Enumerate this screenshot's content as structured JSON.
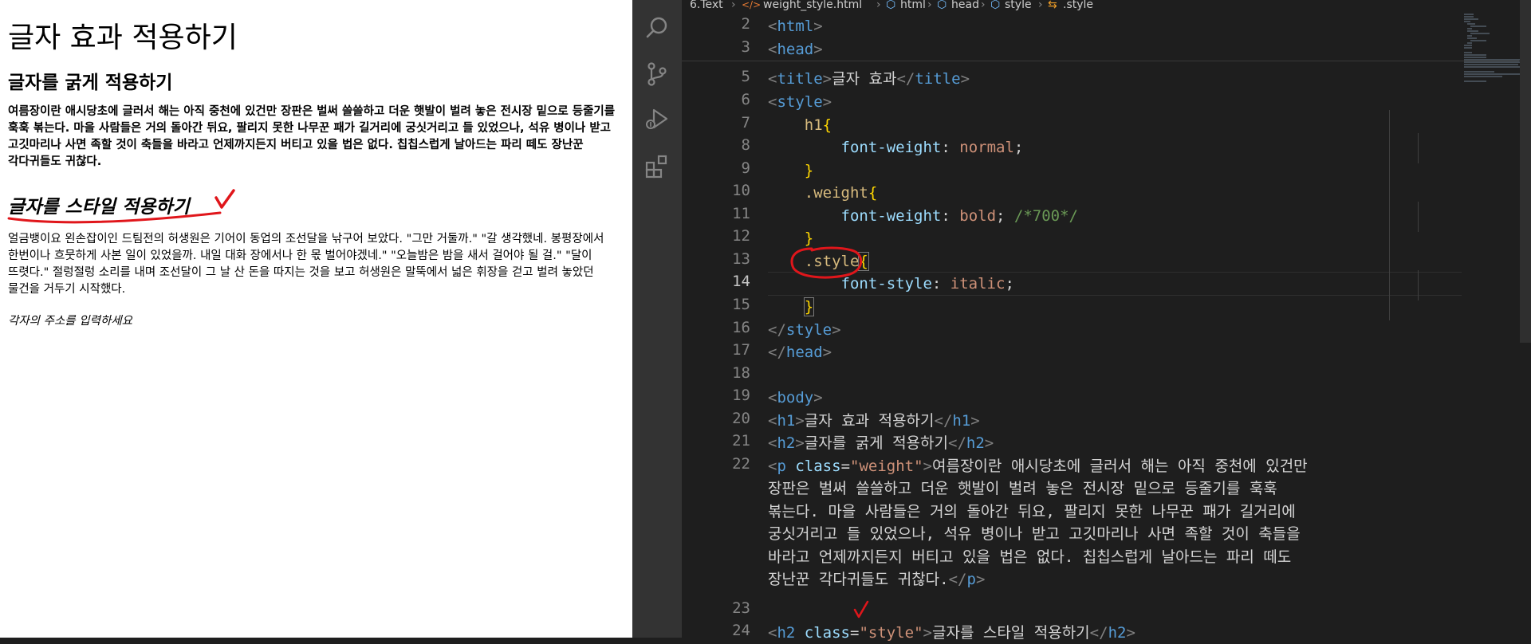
{
  "preview": {
    "h1": "글자 효과 적용하기",
    "h2_weight": "글자를 굵게 적용하기",
    "p_weight": "여름장이란 애시당초에 글러서 해는 아직 중천에 있건만 장판은 벌써 쓸쓸하고 더운 햇발이 벌려 놓은 전시장 밑으로 등줄기를 훅훅 볶는다. 마을 사람들은 거의 돌아간 뒤요, 팔리지 못한 나무꾼 패가 길거리에 궁싯거리고 들 있었으나, 석유 병이나 받고 고깃마리나 사면 족할 것이 축들을 바라고 언제까지든지 버티고 있을 법은 없다. 칩칩스럽게 날아드는 파리 떼도 장난꾼 각다귀들도 귀찮다.",
    "h2_style": "글자를 스타일 적용하기",
    "p_style": "얼금뱅이요 왼손잡이인 드팀전의 허생원은 기어이 동업의 조선달을 낚구어 보았다. \"그만 거둘까.\" \"갈 생각했네. 봉평장에서 한번이나 흐뭇하게 사본 일이 있었을까. 내일 대화 장에서나 한 몫 벌어야겠네.\" \"오늘밤은 밤을 새서 걸어야 될 걸.\" \"달이 뜨렷다.\" 절렁절렁 소리를 내며 조선달이 그 날 산 돈을 따지는 것을 보고 허생원은 말뚝에서 넓은 휘장을 걷고 벌려 놓았던 물건을 거두기 시작했다.",
    "address": "각자의 주소를 입력하세요",
    "annotation_color": "#e0161b"
  },
  "editor": {
    "breadcrumb": [
      "6.Text",
      "weight_style.html",
      "html",
      "head",
      "style",
      ".style"
    ],
    "breadcrumb_icons": [
      "chevron-icon",
      "html-file-icon",
      "element-icon",
      "element-icon",
      "element-icon",
      "css-selector-icon"
    ],
    "activity_icons": [
      "search-icon",
      "source-control-icon",
      "run-debug-icon",
      "extensions-icon"
    ],
    "active_line": "14",
    "line_numbers": [
      "2",
      "3",
      "5",
      "6",
      "7",
      "8",
      "9",
      "10",
      "11",
      "12",
      "13",
      "14",
      "15",
      "16",
      "17",
      "18",
      "19",
      "20",
      "21",
      "22",
      "",
      "",
      "",
      "",
      "",
      "23",
      "24"
    ],
    "code": {
      "l2": "html",
      "l3": "head",
      "l5_tag": "title",
      "l5_text": "글자 효과",
      "l6": "style",
      "l7_sel": "h1",
      "l8_prop": "font-weight",
      "l8_val": "normal",
      "l10_sel": ".weight",
      "l11_prop": "font-weight",
      "l11_val": "bold",
      "l11_cmt": "/*700*/",
      "l13_sel": ".style",
      "l14_prop": "font-style",
      "l14_val": "italic",
      "l16": "style",
      "l17": "head",
      "l19": "body",
      "l20_tag": "h1",
      "l20_text": "글자 효과 적용하기",
      "l21_tag": "h2",
      "l21_text": "글자를 굵게 적용하기",
      "l22_tag": "p",
      "l22_attr": "class",
      "l22_val": "\"weight\"",
      "l22_lines": [
        "여름장이란 애시당초에 글러서 해는 아직 중천에 있건만",
        "장판은 벌써 쓸쓸하고 더운 햇발이 벌려 놓은 전시장 밑으로 등줄기를 훅훅",
        "볶는다. 마을 사람들은 거의 돌아간 뒤요, 팔리지 못한 나무꾼 패가 길거리에",
        "궁싯거리고 들 있었으나, 석유 병이나 받고 고깃마리나 사면 족할 것이 축들을",
        "바라고 언제까지든지 버티고 있을 법은 없다. 칩칩스럽게 날아드는 파리 떼도",
        "장난꾼 각다귀들도 귀찮다."
      ],
      "l22_close": "p",
      "l24_tag": "h2",
      "l24_attr": "class",
      "l24_val": "\"style\"",
      "l24_text": "글자를 스타일 적용하기"
    }
  }
}
